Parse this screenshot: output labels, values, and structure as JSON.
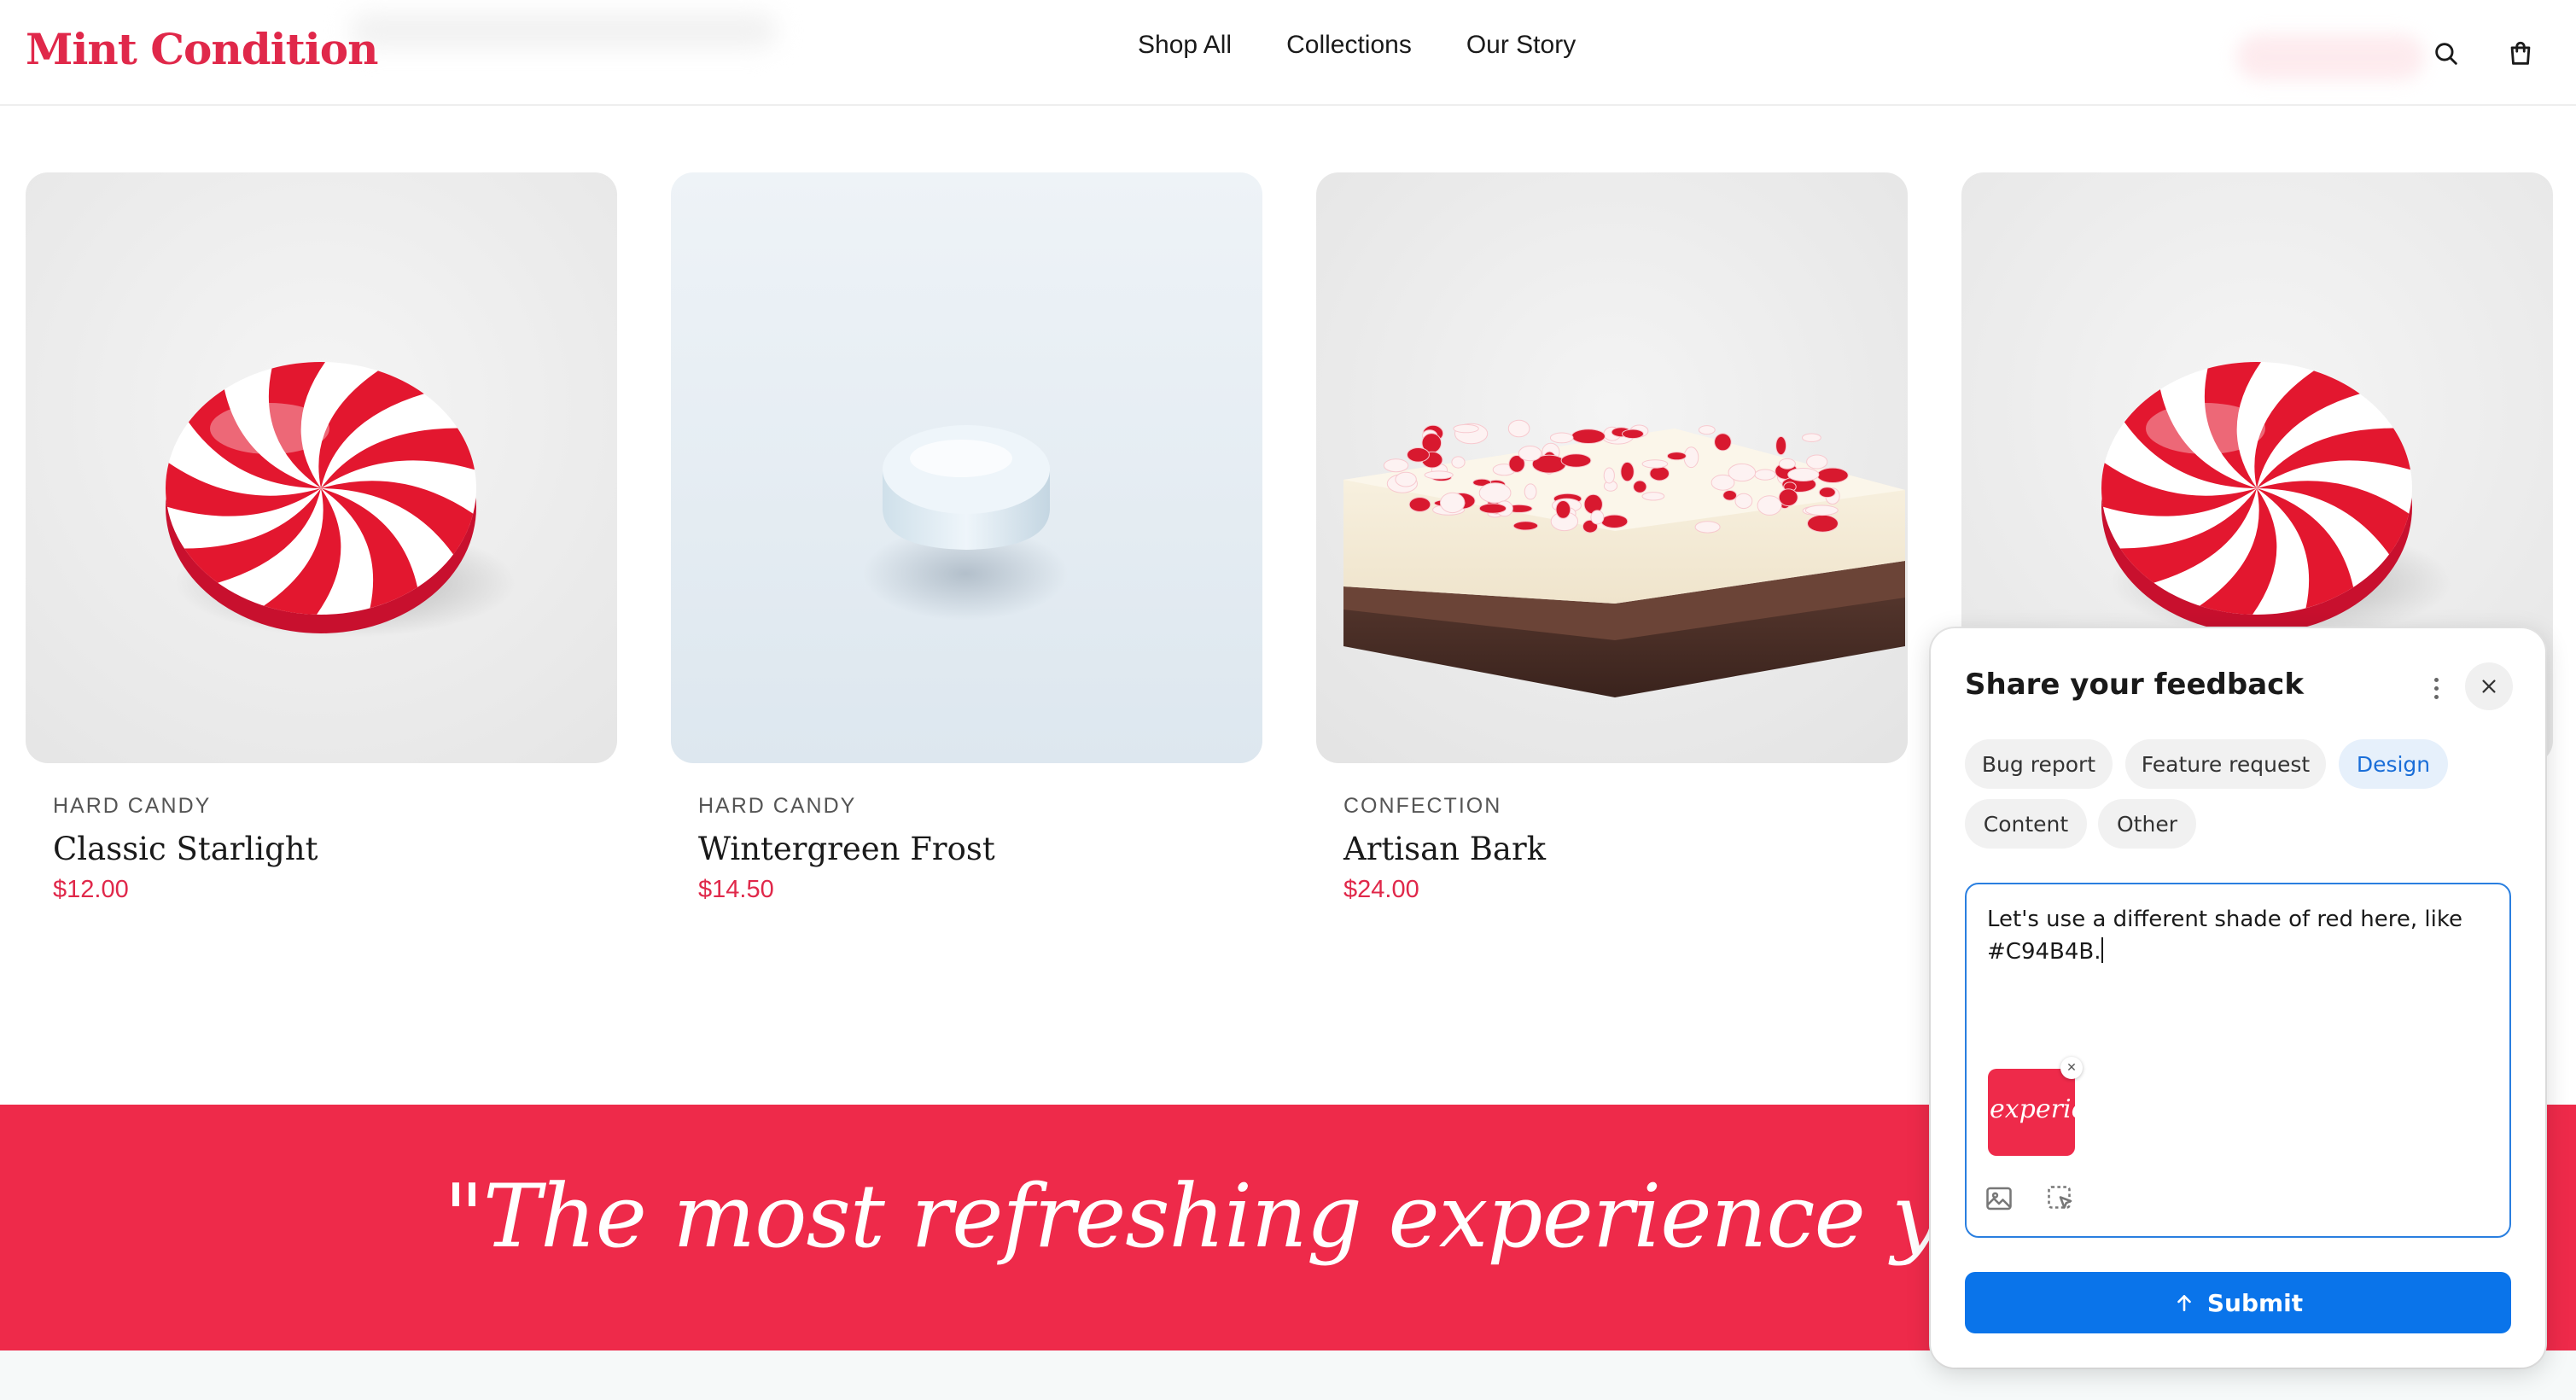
{
  "header": {
    "brand": "Mint Condition",
    "nav": [
      "Shop All",
      "Collections",
      "Our Story"
    ],
    "icons": [
      "search-icon",
      "shopping-bag-icon"
    ]
  },
  "products": [
    {
      "category": "HARD CANDY",
      "name": "Classic Starlight",
      "price": "$12.00",
      "image": "peppermint-swirl"
    },
    {
      "category": "HARD CANDY",
      "name": "Wintergreen Frost",
      "price": "$14.50",
      "image": "white-mint"
    },
    {
      "category": "CONFECTION",
      "name": "Artisan Bark",
      "price": "$24.00",
      "image": "peppermint-bark"
    },
    {
      "image": "peppermint-swirl"
    }
  ],
  "banner": {
    "quote": "\"The most refreshing experience you'll ever"
  },
  "feedback": {
    "title": "Share your feedback",
    "categories": [
      "Bug report",
      "Feature request",
      "Design",
      "Content",
      "Other"
    ],
    "selected_category": "Design",
    "message": "Let's use a different shade of red here, like #C94B4B.",
    "attachment_text": "experie",
    "submit_label": "Submit",
    "icons": [
      "more-vertical-icon",
      "close-icon",
      "image-icon",
      "screenshot-select-icon",
      "arrow-up-icon"
    ]
  },
  "colors": {
    "brand_red": "#e0284a",
    "banner_red": "#ee2a4a",
    "submit_blue": "#0a74ea",
    "active_chip_bg": "#e6f0fb",
    "active_chip_text": "#1a6ed8"
  }
}
